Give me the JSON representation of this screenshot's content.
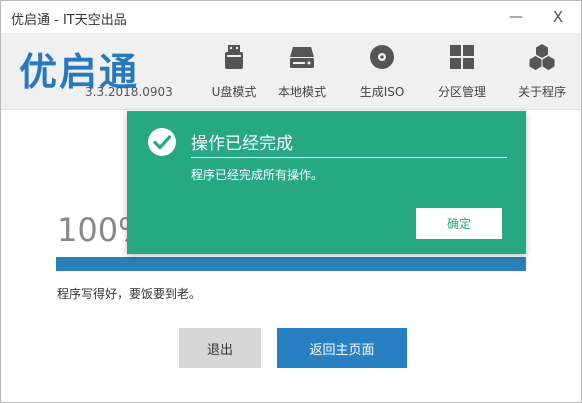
{
  "window": {
    "title": "优启通 - IT天空出品",
    "minimize_glyph": "—",
    "close_glyph": "X"
  },
  "header": {
    "logo_text": "优启通",
    "version": "3.3.2018.0903",
    "nav": [
      {
        "label": "U盘模式",
        "icon": "usb-drive-icon"
      },
      {
        "label": "本地模式",
        "icon": "hard-drive-icon"
      },
      {
        "label": "生成ISO",
        "icon": "disc-icon"
      },
      {
        "label": "分区管理",
        "icon": "partition-grid-icon"
      },
      {
        "label": "关于程序",
        "icon": "about-cubes-icon"
      }
    ]
  },
  "progress": {
    "percent_text": "100%",
    "value": 1.0,
    "status": "程序写得好，要饭要到老。"
  },
  "buttons": {
    "exit": "退出",
    "home": "返回主页面"
  },
  "dialog": {
    "title": "操作已经完成",
    "message": "程序已经完成所有操作。",
    "ok": "确定"
  },
  "colors": {
    "accent_blue": "#2680c2",
    "dialog_green": "#26a882",
    "logo_blue": "#2778bf"
  }
}
